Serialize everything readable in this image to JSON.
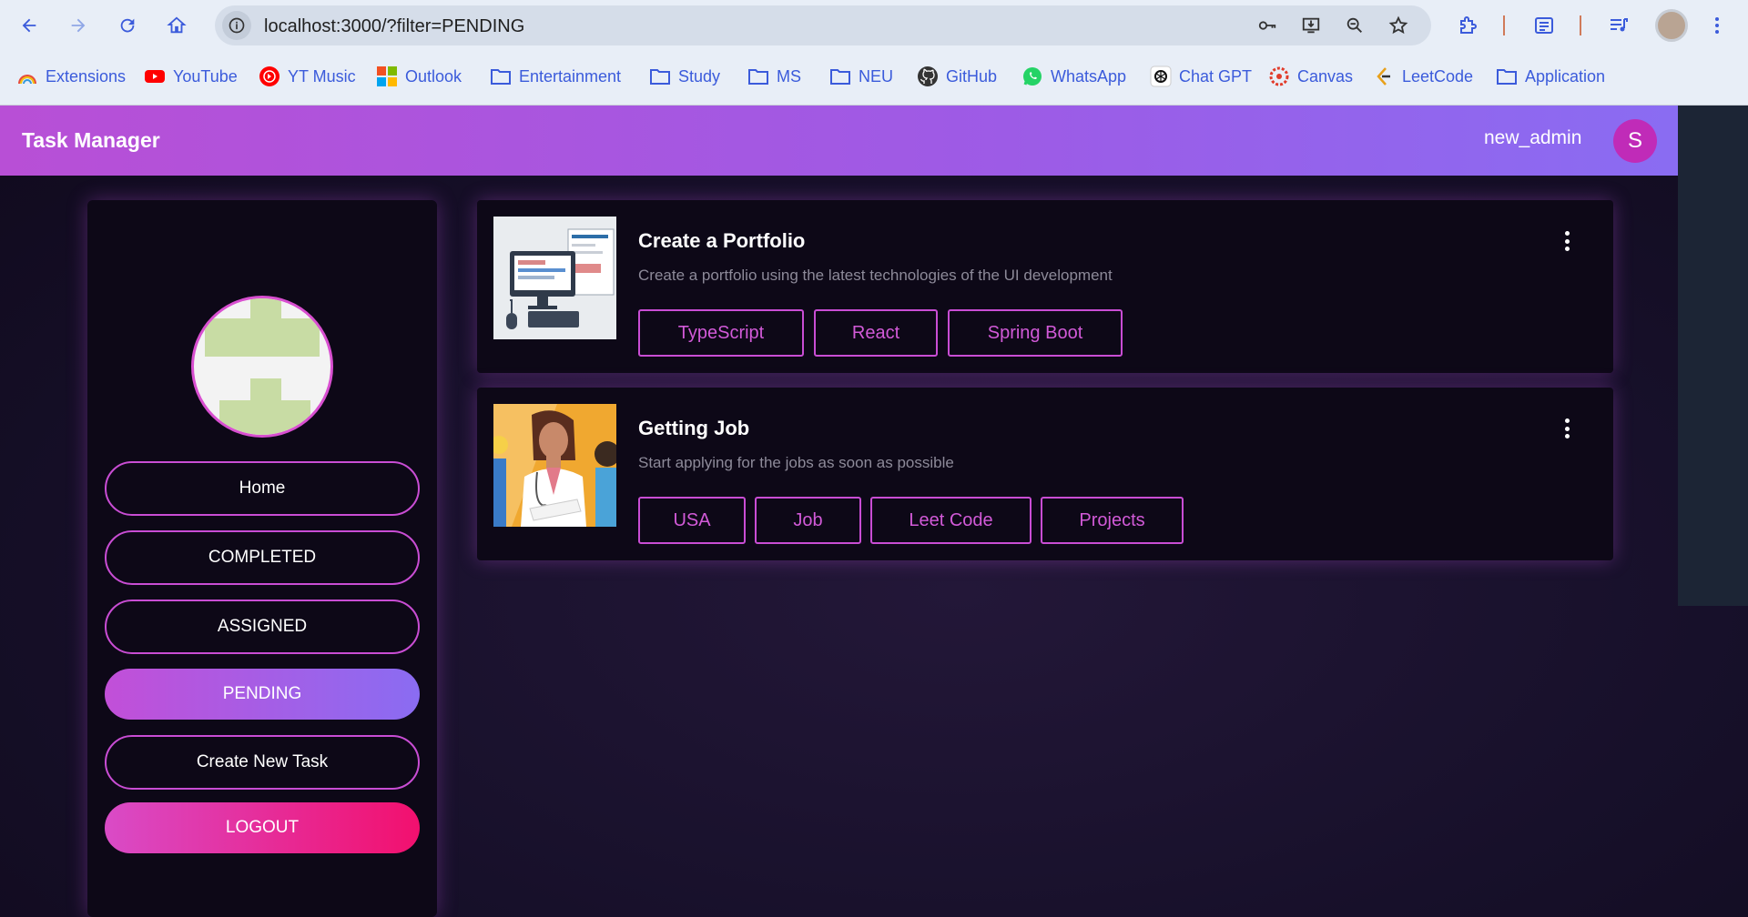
{
  "browser": {
    "url": "localhost:3000/?filter=PENDING",
    "bookmarks": [
      {
        "label": "Extensions",
        "icon": "extensions-rainbow-icon"
      },
      {
        "label": "YouTube",
        "icon": "youtube-icon"
      },
      {
        "label": "YT Music",
        "icon": "yt-music-icon"
      },
      {
        "label": "Outlook",
        "icon": "microsoft-icon"
      },
      {
        "label": "Entertainment",
        "icon": "folder-icon"
      },
      {
        "label": "Study",
        "icon": "folder-icon"
      },
      {
        "label": "MS",
        "icon": "folder-icon"
      },
      {
        "label": "NEU",
        "icon": "folder-icon"
      },
      {
        "label": "GitHub",
        "icon": "github-icon"
      },
      {
        "label": "WhatsApp",
        "icon": "whatsapp-icon"
      },
      {
        "label": "Chat GPT",
        "icon": "chatgpt-icon"
      },
      {
        "label": "Canvas",
        "icon": "canvas-icon"
      },
      {
        "label": "LeetCode",
        "icon": "leetcode-icon"
      },
      {
        "label": "Application",
        "icon": "folder-icon"
      }
    ]
  },
  "app": {
    "brand": "Task Manager",
    "username": "new_admin",
    "avatar_letter": "S"
  },
  "sidebar": {
    "items": [
      {
        "label": "Home"
      },
      {
        "label": "COMPLETED"
      },
      {
        "label": "ASSIGNED"
      },
      {
        "label": "PENDING",
        "active": true
      },
      {
        "label": "Create New Task"
      },
      {
        "label": "LOGOUT"
      }
    ]
  },
  "tasks": [
    {
      "title": "Create a Portfolio",
      "description": "Create a portfolio using the latest technologies of the UI development",
      "tags": [
        "TypeScript",
        "React",
        "Spring Boot"
      ]
    },
    {
      "title": "Getting Job",
      "description": "Start applying for the jobs as soon as possible",
      "tags": [
        "USA",
        "Job",
        "Leet Code",
        "Projects"
      ]
    }
  ],
  "colors": {
    "appbar_start": "#b84fd6",
    "appbar_end": "#8a6cf2",
    "accent": "#c94dd4",
    "logout_end": "#f2106e",
    "link_blue": "#3b5bdb"
  }
}
